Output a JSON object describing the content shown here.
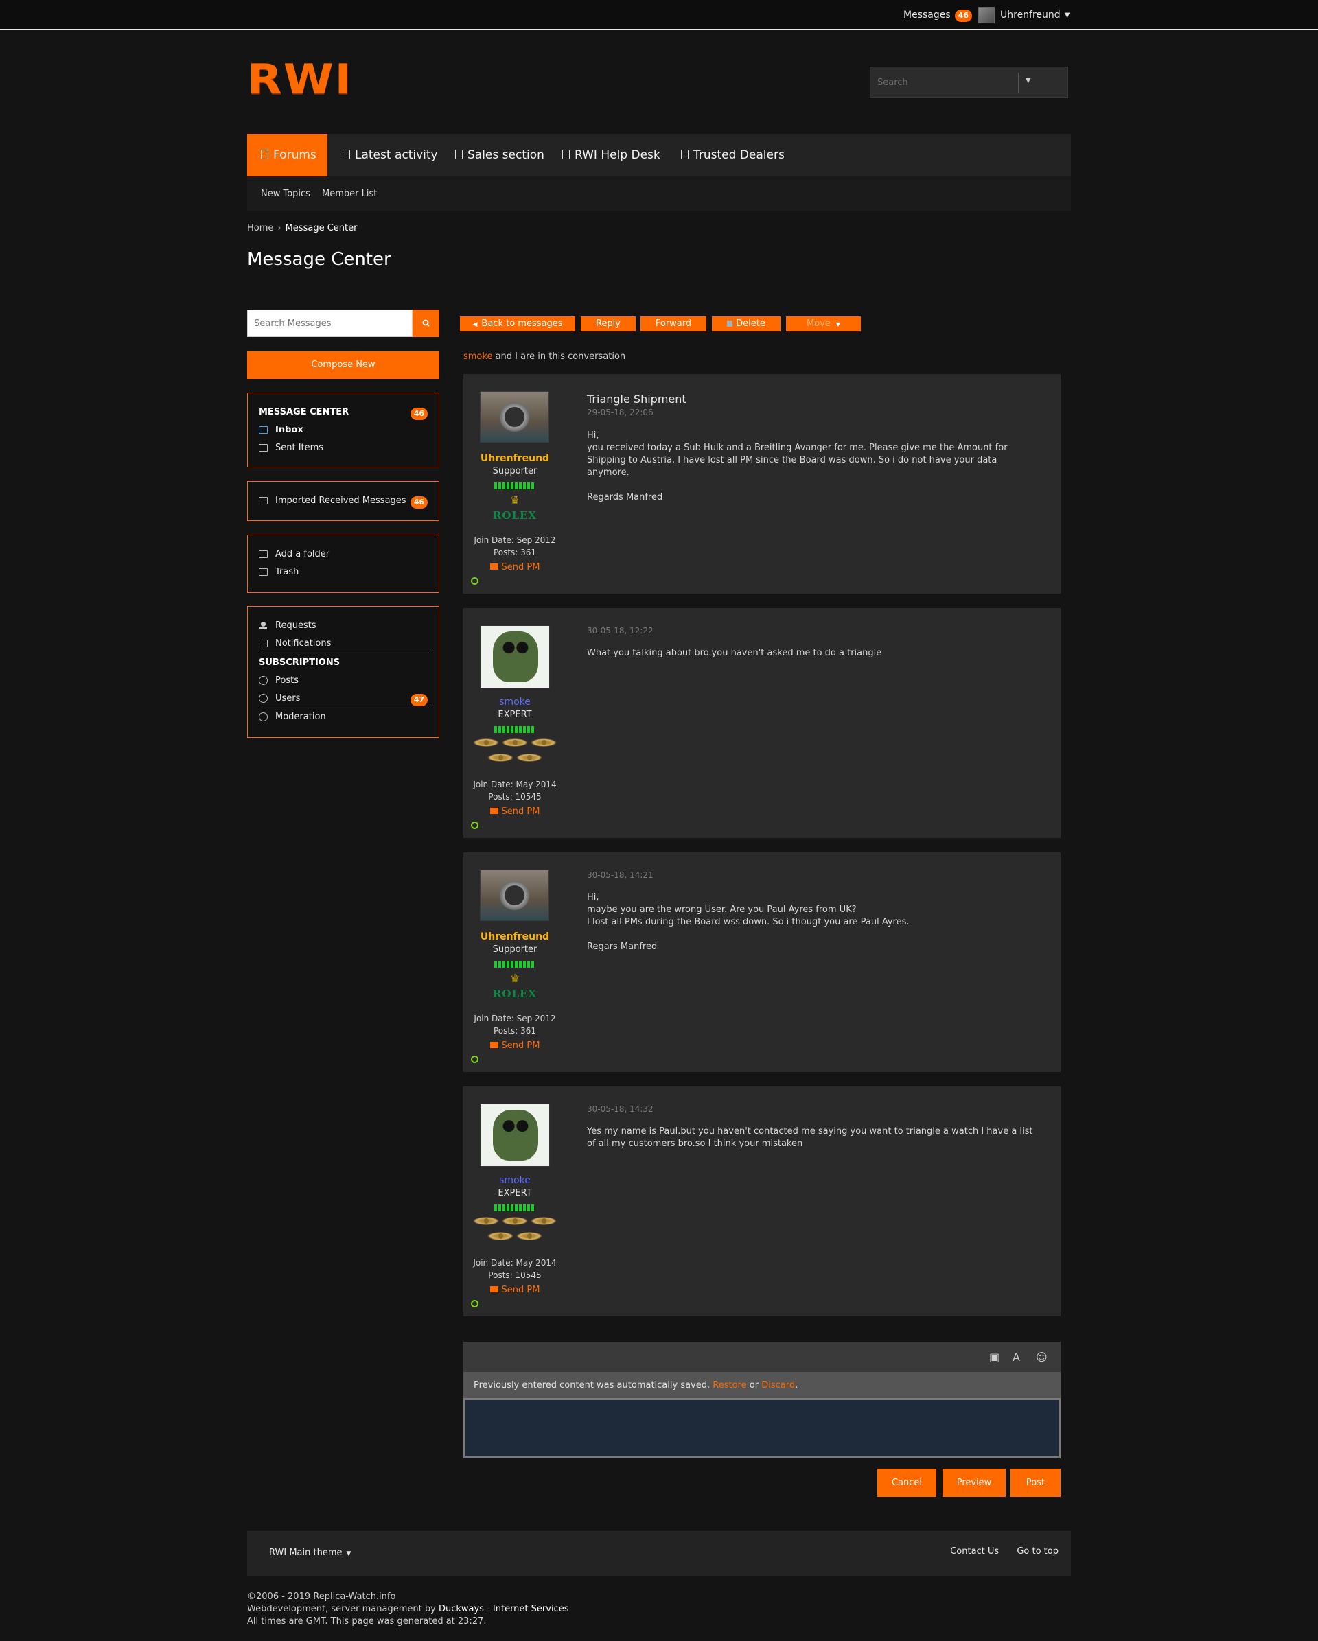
{
  "topbar": {
    "messages_label": "Messages",
    "messages_count": "46",
    "username": "Uhrenfreund"
  },
  "header": {
    "logo": "RWI",
    "search_placeholder": "Search"
  },
  "nav": {
    "tabs": [
      {
        "label": "Forums"
      },
      {
        "label": "Latest activity"
      },
      {
        "label": "Sales section"
      },
      {
        "label": "RWI Help Desk"
      },
      {
        "label": "Trusted Dealers"
      }
    ],
    "subnav": [
      "New Topics",
      "Member List"
    ]
  },
  "breadcrumb": {
    "home": "Home",
    "current": "Message Center"
  },
  "page_title": "Message Center",
  "sidebar": {
    "search_placeholder": "Search Messages",
    "compose": "Compose New",
    "message_center": {
      "heading": "MESSAGE CENTER",
      "count": "46",
      "inbox": "Inbox",
      "sent": "Sent Items"
    },
    "imported": {
      "label": "Imported Received Messages",
      "count": "46"
    },
    "folders": {
      "add": "Add a folder",
      "trash": "Trash"
    },
    "other": {
      "requests": "Requests",
      "notifications": "Notifications",
      "subscriptions_heading": "SUBSCRIPTIONS",
      "posts": "Posts",
      "users": "Users",
      "users_count": "47",
      "moderation": "Moderation"
    }
  },
  "toolbar": {
    "back": "Back to messages",
    "reply": "Reply",
    "forward": "Forward",
    "delete": "Delete",
    "move": "Move"
  },
  "conversation": {
    "participant": "smoke",
    "text": "and I are in this conversation"
  },
  "posts": [
    {
      "author": "Uhrenfreund",
      "usertitle": "Supporter",
      "badge": "ROLEX",
      "join": "Join Date: Sep 2012",
      "posts": "Posts: 361",
      "sendpm": "Send PM",
      "title": "Triangle Shipment",
      "date": "29-05-18, 22:06",
      "body": "Hi,\nyou received today a Sub Hulk and a Breitling Avanger for me. Please give me the Amount for Shipping to Austria. I have lost all PM since the Board was down. So i do not have your data anymore.\n\nRegards Manfred"
    },
    {
      "author": "smoke",
      "usertitle": "EXPERT",
      "join": "Join Date: May 2014",
      "posts": "Posts: 10545",
      "sendpm": "Send PM",
      "date": "30-05-18, 12:22",
      "body": "What you talking about bro.you haven't asked me to do a triangle"
    },
    {
      "author": "Uhrenfreund",
      "usertitle": "Supporter",
      "badge": "ROLEX",
      "join": "Join Date: Sep 2012",
      "posts": "Posts: 361",
      "sendpm": "Send PM",
      "date": "30-05-18, 14:21",
      "body": "Hi,\nmaybe you are the wrong User. Are you Paul Ayres from UK?\nI lost all PMs during the Board wss down. So i thougt you are Paul Ayres.\n\nRegars Manfred"
    },
    {
      "author": "smoke",
      "usertitle": "EXPERT",
      "join": "Join Date: May 2014",
      "posts": "Posts: 10545",
      "sendpm": "Send PM",
      "date": "30-05-18, 14:32",
      "body": "Yes my name is Paul.but you haven't contacted me saying you want to triangle a watch I have a list of all my customers bro.so I think your mistaken"
    }
  ],
  "editor": {
    "autosave_text": "Previously entered content was automatically saved.",
    "restore": "Restore",
    "or": "or",
    "discard": "Discard",
    "cancel": "Cancel",
    "preview": "Preview",
    "post": "Post"
  },
  "footer": {
    "theme": "RWI Main theme",
    "contact": "Contact Us",
    "top": "Go to top",
    "copyright": "©2006 - 2019 Replica-Watch.info",
    "dev_prefix": "Webdevelopment, server management by",
    "dev_company": "Duckways - Internet Services",
    "times": "All times are GMT. This page was generated at 23:27."
  },
  "colors": {
    "accent": "#ff6a00",
    "background": "#141414",
    "panel": "#2a2a2a",
    "online": "#7ed321"
  }
}
